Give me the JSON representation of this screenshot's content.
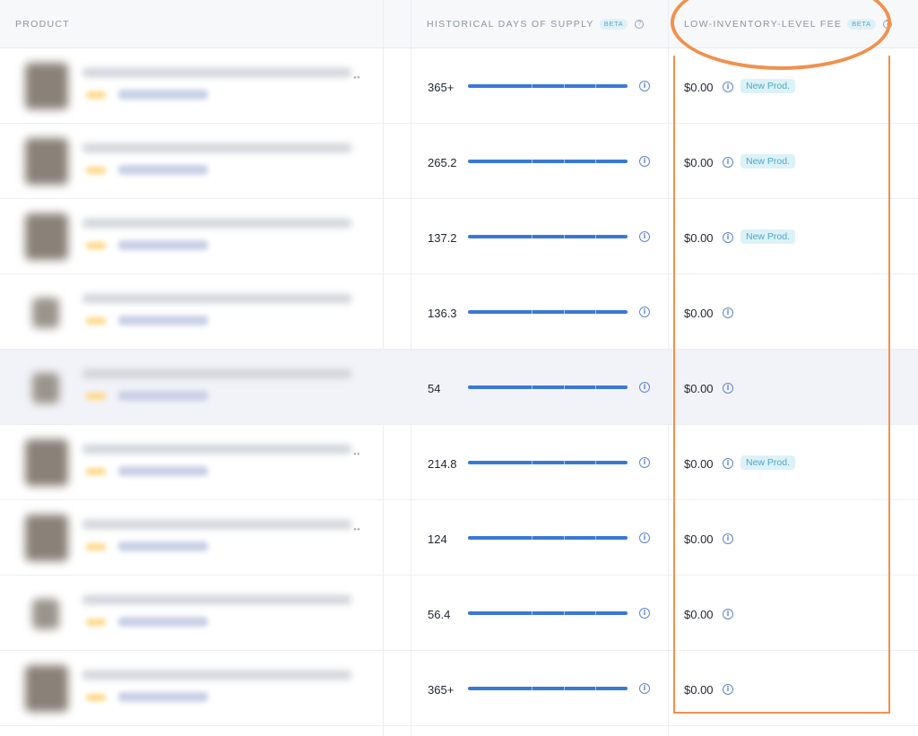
{
  "columns": {
    "product": "PRODUCT",
    "days": "HISTORICAL DAYS OF SUPPLY",
    "days_badge": "BETA",
    "fee": "LOW-INVENTORY-LEVEL FEE",
    "fee_badge": "BETA"
  },
  "icons": {
    "help": "question-circle-icon",
    "info": "info-circle-icon"
  },
  "colors": {
    "bar": "#3a78d6",
    "annotation": "#f0914e",
    "badge_bg": "#dcf2f8",
    "badge_text": "#4ea7c4"
  },
  "rows": [
    {
      "days": "365+",
      "fee": "$0.00",
      "badge": "New Prod."
    },
    {
      "days": "265.2",
      "fee": "$0.00",
      "badge": "New Prod."
    },
    {
      "days": "137.2",
      "fee": "$0.00",
      "badge": "New Prod."
    },
    {
      "days": "136.3",
      "fee": "$0.00",
      "badge": ""
    },
    {
      "days": "54",
      "fee": "$0.00",
      "badge": ""
    },
    {
      "days": "214.8",
      "fee": "$0.00",
      "badge": "New Prod."
    },
    {
      "days": "124",
      "fee": "$0.00",
      "badge": ""
    },
    {
      "days": "56.4",
      "fee": "$0.00",
      "badge": ""
    },
    {
      "days": "365+",
      "fee": "$0.00",
      "badge": ""
    }
  ]
}
